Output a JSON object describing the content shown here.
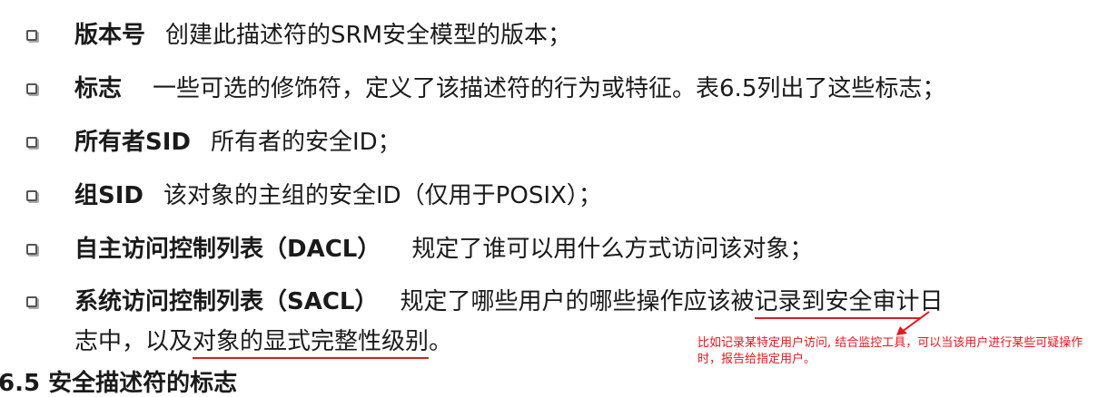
{
  "items": [
    {
      "term": "版本号",
      "desc": "创建此描述符的SRM安全模型的版本；"
    },
    {
      "term": "标志",
      "desc": "一些可选的修饰符，定义了该描述符的行为或特征。表6.5列出了这些标志；"
    },
    {
      "term": "所有者SID",
      "desc": "所有者的安全ID；"
    },
    {
      "term": "组SID",
      "desc": "该对象的主组的安全ID（仅用于POSIX）；"
    },
    {
      "term": "自主访问控制列表（DACL）",
      "desc": "规定了谁可以用什么方式访问该对象；"
    },
    {
      "term": "系统访问控制列表（SACL）",
      "desc_a": "规定了哪些用户的哪些操作应该被",
      "desc_underlined_1": "记录到安全审计",
      "desc_b": "日",
      "line2_a": "志中，以及",
      "line2_underlined": "对象的显式完整性级别",
      "line2_end": "。"
    }
  ],
  "annotation": {
    "text": "比如记录某特定用户访问, 结合监控工具，可以当该用户进行某些可疑操作时，报告给指定用户。",
    "color": "#e8161e"
  },
  "cutoff_heading": "6.5  安全描述符的标志"
}
